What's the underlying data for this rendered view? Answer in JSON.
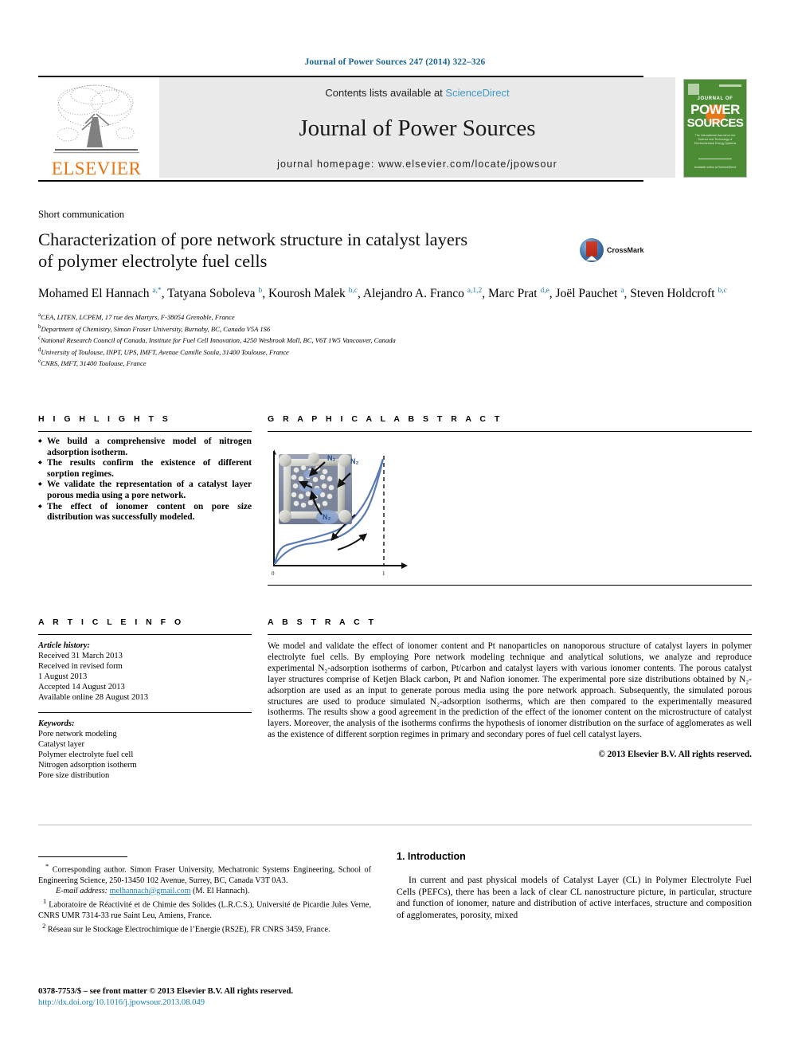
{
  "running_head": "Journal of Power Sources 247 (2014) 322–326",
  "masthead": {
    "publisher": "ELSEVIER",
    "contents_prefix": "Contents lists available at ",
    "contents_link": "ScienceDirect",
    "journal_title": "Journal of Power Sources",
    "homepage": "journal homepage: www.elsevier.com/locate/jpowsour",
    "cover": {
      "journal_of": "JOURNAL OF",
      "word1": "POWER",
      "word2": "SOURCES",
      "subtitle": "The International Journal on the Science and Technology of Electrochemical Energy Systems",
      "footer": "Available online at ScienceDirect"
    },
    "accent_green": "#4c8c34",
    "accent_orange": "#e8761a",
    "link_blue": "#3f9ac9"
  },
  "article": {
    "kind": "Short communication",
    "title_line1": "Characterization of pore network structure in catalyst layers",
    "title_line2": "of polymer electrolyte fuel cells",
    "crossmark_label": "CrossMark",
    "authors_html": "Mohamed El Hannach <sup>a,*</sup>, Tatyana Soboleva <sup>b</sup>, Kourosh Malek <sup>b,c</sup>, Alejandro A. Franco <sup>a,1,2</sup>, Marc Prat <sup>d,e</sup>, Joël Pauchet <sup>a</sup>, Steven Holdcroft <sup>b,c</sup>",
    "affiliations": [
      {
        "marker": "a",
        "text": "CEA, LITEN, LCPEM, 17 rue des Martyrs, F-38054 Grenoble, France"
      },
      {
        "marker": "b",
        "text": "Department of Chemistry, Simon Fraser University, Burnaby, BC, Canada V5A 1S6"
      },
      {
        "marker": "c",
        "text": "National Research Council of Canada, Institute for Fuel Cell Innovation, 4250 Wesbrook Mall, BC, V6T 1W5 Vancouver, Canada"
      },
      {
        "marker": "d",
        "text": "University of Toulouse, INPT, UPS, IMFT, Avenue Camille Soula, 31400 Toulouse, France"
      },
      {
        "marker": "e",
        "text": "CNRS, IMFT, 31400 Toulouse, France"
      }
    ]
  },
  "highlights": {
    "heading": "H I G H L I G H T S",
    "items": [
      "We build a comprehensive model of nitrogen adsorption isotherm.",
      "The results confirm the existence of different sorption regimes.",
      "We validate the representation of a catalyst layer porous media using a pore network.",
      "The effect of ionomer content on pore size distribution was successfully modeled."
    ]
  },
  "graphical_abstract": {
    "heading": "G R A P H I C A L   A B S T R A C T",
    "labels": {
      "gas1": "N₂",
      "gas2": "N₂",
      "gas3": "N₂"
    },
    "axis_ticks": {
      "x_min": "0",
      "x_max": "1"
    },
    "curve_color": "#5b7bb4"
  },
  "article_info": {
    "heading": "A R T I C L E   I N F O",
    "history_label": "Article history:",
    "history": [
      "Received 31 March 2013",
      "Received in revised form",
      "1 August 2013",
      "Accepted 14 August 2013",
      "Available online 28 August 2013"
    ],
    "keywords_label": "Keywords:",
    "keywords": [
      "Pore network modeling",
      "Catalyst layer",
      "Polymer electrolyte fuel cell",
      "Nitrogen adsorption isotherm",
      "Pore size distribution"
    ]
  },
  "abstract": {
    "heading": "A B S T R A C T",
    "text": "We model and validate the effect of ionomer content and Pt nanoparticles on nanoporous structure of catalyst layers in polymer electrolyte fuel cells. By employing Pore network modeling technique and analytical solutions, we analyze and reproduce experimental N₂-adsorption isotherms of carbon, Pt/carbon and catalyst layers with various ionomer contents. The porous catalyst layer structures comprise of Ketjen Black carbon, Pt and Nafion ionomer. The experimental pore size distributions obtained by N₂-adsorption are used as an input to generate porous media using the pore network approach. Subsequently, the simulated porous structures are used to produce simulated N₂-adsorption isotherms, which are then compared to the experimentally measured isotherms. The results show a good agreement in the prediction of the effect of the ionomer content on the microstructure of catalyst layers. Moreover, the analysis of the isotherms confirms the hypothesis of ionomer distribution on the surface of agglomerates as well as the existence of different sorption regimes in primary and secondary pores of fuel cell catalyst layers.",
    "copyright": "© 2013 Elsevier B.V. All rights reserved."
  },
  "footnotes": {
    "corresponding_marker": "*",
    "corresponding": "Corresponding author. Simon Fraser University, Mechatronic Systems Engineering, School of Engineering Science, 250-13450 102 Avenue, Surrey, BC, Canada V3T 0A3.",
    "email_label": "E-mail address:",
    "email": "melhannach@gmail.com",
    "email_owner": "(M. El Hannach).",
    "note1_marker": "1",
    "note1": "Laboratoire de Réactivité et de Chimie des Solides (L.R.C.S.), Université de Picardie Jules Verne, CNRS UMR 7314-33 rue Saint Leu, Amiens, France.",
    "note2_marker": "2",
    "note2": "Réseau sur le Stockage Electrochimique de l’Energie (RS2E), FR CNRS 3459, France."
  },
  "footer": {
    "issn_line": "0378-7753/$ – see front matter © 2013 Elsevier B.V. All rights reserved.",
    "doi": "http://dx.doi.org/10.1016/j.jpowsour.2013.08.049"
  },
  "introduction": {
    "number_title": "1. Introduction",
    "paragraph": "In current and past physical models of Catalyst Layer (CL) in Polymer Electrolyte Fuel Cells (PEFCs), there has been a lack of clear CL nanostructure picture, in particular, structure and function of ionomer, nature and distribution of active interfaces, structure and composition of agglomerates, porosity, mixed"
  }
}
